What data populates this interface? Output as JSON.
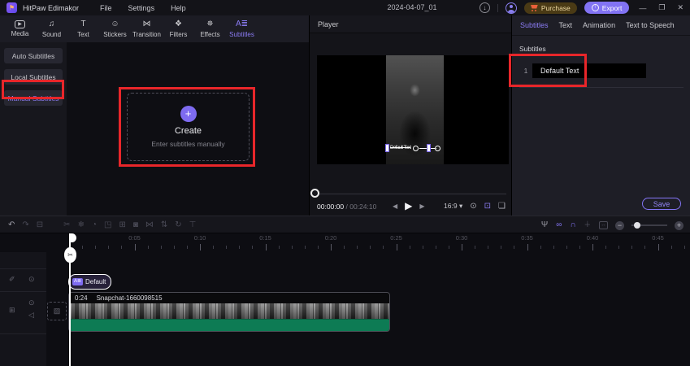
{
  "colors": {
    "accent": "#8576f7",
    "highlight_red": "#e8262a",
    "audio_green": "#0d7b54"
  },
  "menubar": {
    "app_name": "HitPaw Edimakor",
    "logo_glyph": "⚑",
    "menus": [
      "File",
      "Settings",
      "Help"
    ],
    "project_title": "2024-04-07_01",
    "download_glyph": "↓",
    "purchase_label": "Purchase",
    "export_label": "Export",
    "export_glyph": "↑",
    "window_controls": {
      "minimize": "—",
      "maximize": "❐",
      "close": "✕"
    }
  },
  "ribbon": {
    "tabs": [
      {
        "label": "Media",
        "glyph": "▶",
        "boxed": true,
        "active": false
      },
      {
        "label": "Sound",
        "glyph": "♫",
        "active": false
      },
      {
        "label": "Text",
        "glyph": "T",
        "active": false
      },
      {
        "label": "Stickers",
        "glyph": "☺",
        "active": false
      },
      {
        "label": "Transition",
        "glyph": "⋈",
        "active": false
      },
      {
        "label": "Filters",
        "glyph": "❖",
        "active": false
      },
      {
        "label": "Effects",
        "glyph": "✵",
        "active": false
      },
      {
        "label": "Subtitles",
        "glyph": "A≣",
        "active": true
      }
    ]
  },
  "sidebar": {
    "items": [
      {
        "label": "Auto Subtitles",
        "active": false
      },
      {
        "label": "Local Subtitles",
        "active": false
      },
      {
        "label": "Manual Subtitles",
        "active": true
      }
    ]
  },
  "create_panel": {
    "plus_glyph": "+",
    "title": "Create",
    "subtitle": "Enter subtitles manually"
  },
  "player": {
    "title": "Player",
    "overlay_text": "Default Text",
    "current_time": "00:00:00",
    "time_separator": "/",
    "total_time": "00:24:10",
    "controls": {
      "prev": "◀",
      "play": "▶",
      "next": "▶"
    },
    "aspect_ratio": "16:9",
    "aspect_caret": "▾",
    "icons": [
      {
        "name": "snapshot",
        "glyph": "⊙",
        "active": false
      },
      {
        "name": "frame-crop",
        "glyph": "⊡",
        "active": true
      },
      {
        "name": "fullscreen",
        "glyph": "❏",
        "active": false
      }
    ]
  },
  "properties_panel": {
    "tabs": [
      {
        "label": "Subtitles",
        "active": true
      },
      {
        "label": "Text",
        "active": false
      },
      {
        "label": "Animation",
        "active": false
      },
      {
        "label": "Text to Speech",
        "active": false
      }
    ],
    "section_label": "Subtitles",
    "rows": [
      {
        "index": "1",
        "text": "Default Text"
      }
    ],
    "save_label": "Save"
  },
  "timeline_toolbar": {
    "left_tools": [
      {
        "name": "undo",
        "glyph": "↶",
        "tone": "bright"
      },
      {
        "name": "redo",
        "glyph": "↷",
        "tone": "dim"
      },
      {
        "name": "delete",
        "glyph": "⊟",
        "tone": "dim"
      },
      {
        "name": "split",
        "glyph": "✂",
        "tone": "dim",
        "gap": true
      },
      {
        "name": "freeze",
        "glyph": "❄",
        "tone": "dim"
      },
      {
        "name": "speed",
        "glyph": "◔",
        "tone": "dim"
      },
      {
        "name": "crop",
        "glyph": "◳",
        "tone": "dim"
      },
      {
        "name": "copy",
        "glyph": "⊞",
        "tone": "dim"
      },
      {
        "name": "mask",
        "glyph": "◙",
        "tone": "dim"
      },
      {
        "name": "mirror",
        "glyph": "⋈",
        "tone": "dim"
      },
      {
        "name": "flip-vertical",
        "glyph": "⇅",
        "tone": "dim"
      },
      {
        "name": "rotate",
        "glyph": "↻",
        "tone": "dim"
      },
      {
        "name": "text-tool",
        "glyph": "⊤",
        "tone": "dim"
      }
    ],
    "right_tools": [
      {
        "name": "record-voiceover",
        "glyph": "Ψ",
        "tone": "bright"
      },
      {
        "name": "link-clips",
        "glyph": "∞",
        "tone": "accent"
      },
      {
        "name": "magnet-snap",
        "glyph": "∩",
        "tone": "accent"
      },
      {
        "name": "snap-playhead",
        "glyph": "∔",
        "tone": "dim"
      },
      {
        "name": "auto-ripple",
        "glyph": "↔",
        "tone": "dim",
        "boxed": true
      }
    ],
    "zoom_out_glyph": "−",
    "zoom_in_glyph": "+"
  },
  "timeline": {
    "ruler_labels": [
      "0:05",
      "0:10",
      "0:15",
      "0:20",
      "0:25",
      "0:30",
      "0:35",
      "0:40",
      "0:45"
    ],
    "track_headers": {
      "pin_glyph": "✐",
      "eye_glyph": "⊙",
      "type_glyph": "⊞",
      "speaker_glyph": "◁",
      "add_glyph": "▧"
    },
    "playhead_glyph": "✂",
    "subtitle_clip": {
      "badge": "A≣",
      "label": "Default"
    },
    "video_clip": {
      "duration": "0:24",
      "name": "Snapchat-1660098515"
    }
  }
}
